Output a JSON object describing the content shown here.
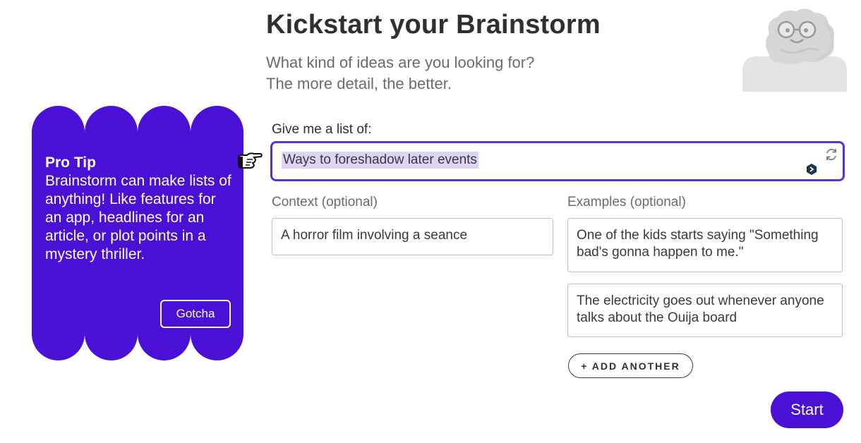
{
  "header": {
    "title": "Kickstart your Brainstorm",
    "subtitle_line1": "What kind of ideas are you looking for?",
    "subtitle_line2": "The more detail, the better."
  },
  "tip": {
    "title": "Pro Tip",
    "text": "Brainstorm can make lists of anything! Like features for an app, headlines for an article, or plot points in a mystery thriller.",
    "button_label": "Gotcha",
    "color": "#4a10d6"
  },
  "form": {
    "list_label": "Give me a list of:",
    "list_value": "Ways to foreshadow later events",
    "context_label": "Context (optional)",
    "context_value": "A horror film involving a seance",
    "examples_label": "Examples (optional)",
    "examples": [
      "One of the kids starts saying \"Something bad's gonna happen to me.\"",
      "The electricity goes out whenever anyone talks about the Ouija board"
    ],
    "add_label": "+ ADD ANOTHER",
    "start_label": "Start"
  },
  "colors": {
    "accent": "#4a10d6",
    "focus_border": "#5a31d6",
    "selection": "#dcd3f7"
  },
  "icons": [
    "mascot-brain-icon",
    "pointing-hand-icon",
    "refresh-icon",
    "extension-icon"
  ]
}
